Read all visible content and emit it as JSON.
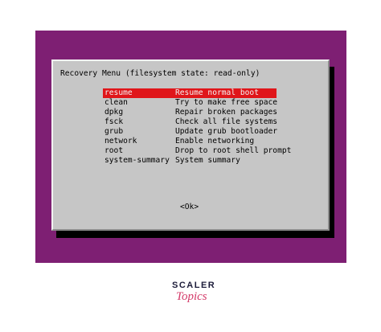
{
  "dialog": {
    "title": "Recovery Menu (filesystem state: read-only)",
    "selected_index": 0,
    "ok_label": "<Ok>"
  },
  "menu": {
    "items": [
      {
        "key": "resume",
        "description": "Resume normal boot"
      },
      {
        "key": "clean",
        "description": "Try to make free space"
      },
      {
        "key": "dpkg",
        "description": "Repair broken packages"
      },
      {
        "key": "fsck",
        "description": "Check all file systems"
      },
      {
        "key": "grub",
        "description": "Update grub bootloader"
      },
      {
        "key": "network",
        "description": "Enable networking"
      },
      {
        "key": "root",
        "description": "Drop to root shell prompt"
      },
      {
        "key": "system-summary",
        "description": "System summary"
      }
    ]
  },
  "logo": {
    "line1": "SCALER",
    "line2": "Topics"
  },
  "colors": {
    "screen_background": "#7e1f73",
    "dialog_background": "#c6c6c6",
    "selection_highlight": "#e0161a",
    "logo_dark": "#1c1c3a",
    "logo_accent": "#d43b6a"
  }
}
